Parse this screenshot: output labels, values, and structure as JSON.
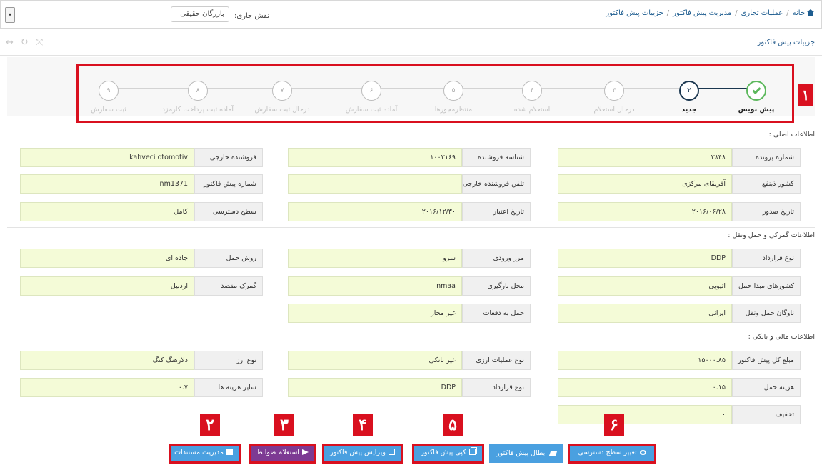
{
  "topbar": {
    "menu_toggle": "▾",
    "role_label": "نقش جاری:",
    "role_value": "بازرگان حقیقی",
    "breadcrumb": [
      "خانه",
      "عملیات تجاری",
      "مدیریت پیش فاکتور",
      "جزییات پیش فاکتور"
    ]
  },
  "subheader": {
    "title": "جزییات پیش فاکتور",
    "tool_icons": [
      "expand-icon",
      "refresh-icon",
      "collapse-icon"
    ]
  },
  "markers": [
    "۱",
    "۲",
    "۳",
    "۴",
    "۵",
    "۶"
  ],
  "stepper": {
    "steps": [
      {
        "number": "",
        "label": "پیش نویس",
        "state": "done"
      },
      {
        "number": "۲",
        "label": "جدید",
        "state": "active"
      },
      {
        "number": "۳",
        "label": "درحال استعلام",
        "state": "pending"
      },
      {
        "number": "۴",
        "label": "استعلام شده",
        "state": "pending"
      },
      {
        "number": "۵",
        "label": "منتظرمجوزها",
        "state": "pending"
      },
      {
        "number": "۶",
        "label": "آماده ثبت سفارش",
        "state": "pending"
      },
      {
        "number": "۷",
        "label": "درحال ثبت سفارش",
        "state": "pending"
      },
      {
        "number": "۸",
        "label": "آماده ثبت پرداخت کارمزد",
        "state": "pending"
      },
      {
        "number": "۹",
        "label": "ثبت سفارش",
        "state": "pending"
      }
    ]
  },
  "main_info": {
    "title": "اطلاعات اصلی :",
    "fields": [
      {
        "label": "شماره پرونده",
        "value": "۳۸۴۸"
      },
      {
        "label": "شناسه فروشنده",
        "value": "۱۰۰۳۱۶۹"
      },
      {
        "label": "فروشنده خارجی",
        "value": "kahveci otomotiv"
      },
      {
        "label": "کشور ذینفع",
        "value": "آفریقای مرکزی"
      },
      {
        "label": "تلفن فروشنده خارجی",
        "value": ""
      },
      {
        "label": "شماره پیش فاکتور",
        "value": "nm1371"
      },
      {
        "label": "تاریخ صدور",
        "value": "۲۰۱۶/۰۶/۲۸"
      },
      {
        "label": "تاریخ اعتبار",
        "value": "۲۰۱۶/۱۲/۳۰"
      },
      {
        "label": "سطح دسترسی",
        "value": "کامل"
      }
    ]
  },
  "customs_info": {
    "title": "اطلاعات گمرکی و حمل ونقل :",
    "fields": [
      {
        "label": "نوع قرارداد",
        "value": "DDP"
      },
      {
        "label": "مرز ورودی",
        "value": "سرو"
      },
      {
        "label": "روش حمل",
        "value": "جاده ای"
      },
      {
        "label": "کشورهای مبدا حمل",
        "value": "اتیوپی"
      },
      {
        "label": "محل بارگیری",
        "value": "nmaa"
      },
      {
        "label": "گمرک مقصد",
        "value": "اردبیل"
      },
      {
        "label": "ناوگان حمل ونقل",
        "value": "ایرانی"
      },
      {
        "label": "حمل به دفعات",
        "value": "غیر مجاز"
      }
    ]
  },
  "finance_info": {
    "title": "اطلاعات مالی و بانکی :",
    "fields": [
      {
        "label": "مبلغ کل پیش فاکتور",
        "value": "۱۵۰۰۰.۸۵"
      },
      {
        "label": "نوع عملیات ارزی",
        "value": "غیر بانکی"
      },
      {
        "label": "نوع ارز",
        "value": "دلارهنگ کنگ"
      },
      {
        "label": "هزینه حمل",
        "value": "۰.۱۵"
      },
      {
        "label": "نوع قرارداد",
        "value": "DDP"
      },
      {
        "label": "سایر هزینه ها",
        "value": "۰.۷"
      },
      {
        "label": "تخفیف",
        "value": "۰"
      }
    ]
  },
  "actions": {
    "change_access": "تغییر سطح دسترسی",
    "cancel_invoice": "ابطال پیش فاکتور",
    "copy_invoice": "کپی پیش فاکتور",
    "edit_invoice": "ویرایش پیش فاکتور",
    "inquiry_rules": "استعلام ضوابط",
    "manage_docs": "مدیریت مستندات"
  },
  "colors": {
    "highlight_red": "#d9101f",
    "step_done": "#5cb85c",
    "step_active": "#1b3750",
    "value_bg": "#f4fbd7",
    "button_blue": "#4aa0e0",
    "button_purple": "#7d3a93"
  }
}
